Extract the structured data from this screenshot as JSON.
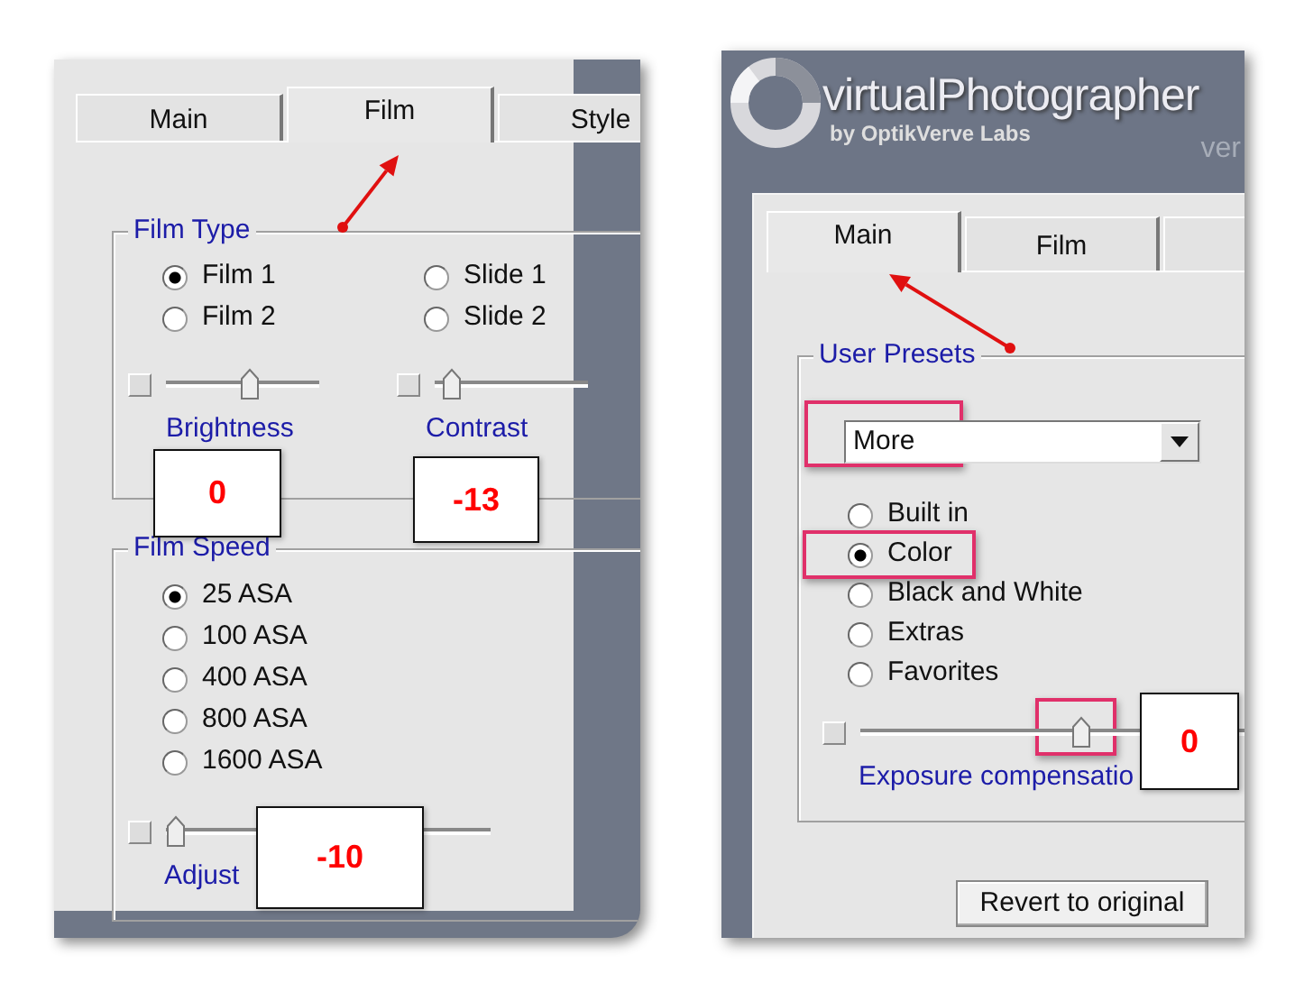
{
  "left_panel": {
    "tabs": [
      {
        "label": "Main",
        "selected": false
      },
      {
        "label": "Film",
        "selected": true
      },
      {
        "label": "Style",
        "selected": false
      }
    ],
    "film_type": {
      "title": "Film Type",
      "options": [
        {
          "label": "Film 1",
          "selected": true
        },
        {
          "label": "Slide 1",
          "selected": false
        },
        {
          "label": "Film 2",
          "selected": false
        },
        {
          "label": "Slide 2",
          "selected": false
        }
      ],
      "sliders": [
        {
          "label": "Brightness",
          "checked": false,
          "level": 0.54,
          "callout": "0"
        },
        {
          "label": "Contrast",
          "checked": false,
          "level": 0.1,
          "callout": "-13"
        }
      ]
    },
    "film_speed": {
      "title": "Film Speed",
      "options": [
        {
          "label": "25 ASA",
          "selected": true
        },
        {
          "label": "100 ASA",
          "selected": false
        },
        {
          "label": "400 ASA",
          "selected": false
        },
        {
          "label": "800 ASA",
          "selected": false
        },
        {
          "label": "1600 ASA",
          "selected": false
        }
      ],
      "slider": {
        "label": "Adjust",
        "checked": false,
        "level": 0.03,
        "callout": "-10"
      }
    }
  },
  "right_panel": {
    "logo": {
      "name": "virtualPhotographer",
      "byline": "by OptikVerve Labs"
    },
    "version": "ver",
    "tabs": [
      {
        "label": "Main",
        "selected": true
      },
      {
        "label": "Film",
        "selected": false
      },
      {
        "selected": false
      }
    ],
    "user_presets": {
      "title": "User Presets",
      "dropdown": {
        "value": "More",
        "highlighted": true
      },
      "options": [
        {
          "label": "Built in",
          "selected": false,
          "highlighted": false
        },
        {
          "label": "Color",
          "selected": true,
          "highlighted": true
        },
        {
          "label": "Black and White",
          "selected": false,
          "highlighted": false
        },
        {
          "label": "Extras",
          "selected": false,
          "highlighted": false
        },
        {
          "label": "Favorites",
          "selected": false,
          "highlighted": false
        }
      ],
      "slider": {
        "label": "Exposure compensatio",
        "checked": false,
        "level": 0.51,
        "highlighted": true,
        "callout": "0"
      }
    },
    "button": "Revert to original"
  }
}
